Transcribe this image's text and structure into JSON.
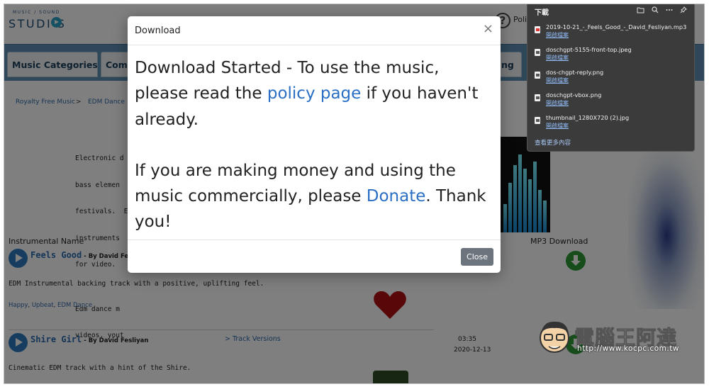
{
  "site": {
    "logo_top": "MUSIC / SOUND",
    "logo_main": "STUDI S",
    "help_label": "Poli",
    "nav_tabs": [
      "Music Categories",
      "Comm",
      "ng"
    ],
    "breadcrumb": [
      "Royalty Free Music",
      ">",
      "EDM Dance"
    ],
    "intro_lines": [
      "Electronic d",
      "bass elemen",
      "festivals.  E",
      "instruments",
      "for video.",
      "",
      "Edm dance m",
      "videos, yout"
    ],
    "col_instrumental": "Instrumental Name",
    "col_mp3": "MP3 Download"
  },
  "tracks": [
    {
      "title": "Feels Good",
      "by": " - By David Fe",
      "desc": "EDM Instrumental backing track with a positive, uplifting feel.",
      "tags": [
        "Happy",
        "Upbeat",
        "EDM Dance"
      ]
    },
    {
      "title": "Shire Girl",
      "by": " - By David Fesliyan",
      "versions": "> Track Versions",
      "duration": "03:35",
      "date": "2020-12-13",
      "desc": "Cinematic EDM track with a hint of the Shire."
    }
  ],
  "modal": {
    "title": "Download",
    "close_x": "×",
    "body_part1": "Download Started - To use the music, please read the ",
    "policy_link": "policy page",
    "body_part2": " if you haven't already.",
    "body_part3": "If you are making money and using the music commercially, please ",
    "donate_link": "Donate",
    "body_part4": ". Thank you!",
    "close_button": "Close"
  },
  "downloads": {
    "title": "下載",
    "tool_icons": [
      "folder-icon",
      "search-icon",
      "more-icon",
      "pin-icon"
    ],
    "items": [
      {
        "name": "2019-10-21_-_Feels_Good_-_David_Fesliyan.mp3",
        "action": "開啟檔案",
        "type": "pdf"
      },
      {
        "name": "doschgpt-5155-front-top.jpeg",
        "action": "開啟檔案",
        "type": "img"
      },
      {
        "name": "dos-chgpt-reply.png",
        "action": "開啟檔案",
        "type": "img"
      },
      {
        "name": "doschgpt-vbox.png",
        "action": "開啟檔案",
        "type": "img"
      },
      {
        "name": "thumbnail_1280X720 (2).jpg",
        "action": "開啟檔案",
        "type": "img"
      }
    ],
    "more": "查看更多內容"
  },
  "watermark": {
    "text": "電腦王阿達",
    "url": "http://www.kocpc.com.tw"
  },
  "colors": {
    "nav": "#5c90b5",
    "link": "#2a6fc4",
    "close_button": "#6c757d",
    "panel": "#3b3b3b"
  }
}
